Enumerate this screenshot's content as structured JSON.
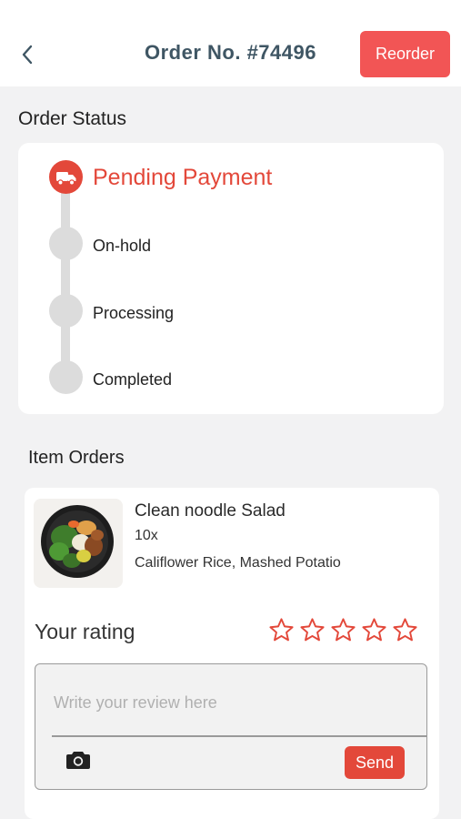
{
  "header": {
    "title": "Order No. #74496",
    "reorder_label": "Reorder",
    "back_icon": "chevron-left-icon"
  },
  "order_status": {
    "title": "Order Status",
    "steps": [
      {
        "label": "Pending Payment",
        "active": true,
        "icon": "truck-icon"
      },
      {
        "label": "On-hold",
        "active": false
      },
      {
        "label": "Processing",
        "active": false
      },
      {
        "label": "Completed",
        "active": false
      }
    ]
  },
  "item_orders": {
    "title": "Item Orders",
    "items": [
      {
        "name": "Clean noodle Salad",
        "quantity": "10x",
        "options": "Califlower Rice, Mashed Potatio"
      }
    ]
  },
  "rating": {
    "label": "Your rating",
    "stars_total": 5,
    "stars_selected": 0,
    "review_placeholder": "Write your review here",
    "review_value": "",
    "send_label": "Send",
    "camera_icon": "camera-icon"
  },
  "colors": {
    "accent": "#e3483a",
    "reorder_button": "#f25555",
    "title_text": "#3f5664",
    "inactive_step": "#dcdcdc",
    "background": "#f2f2f3"
  }
}
